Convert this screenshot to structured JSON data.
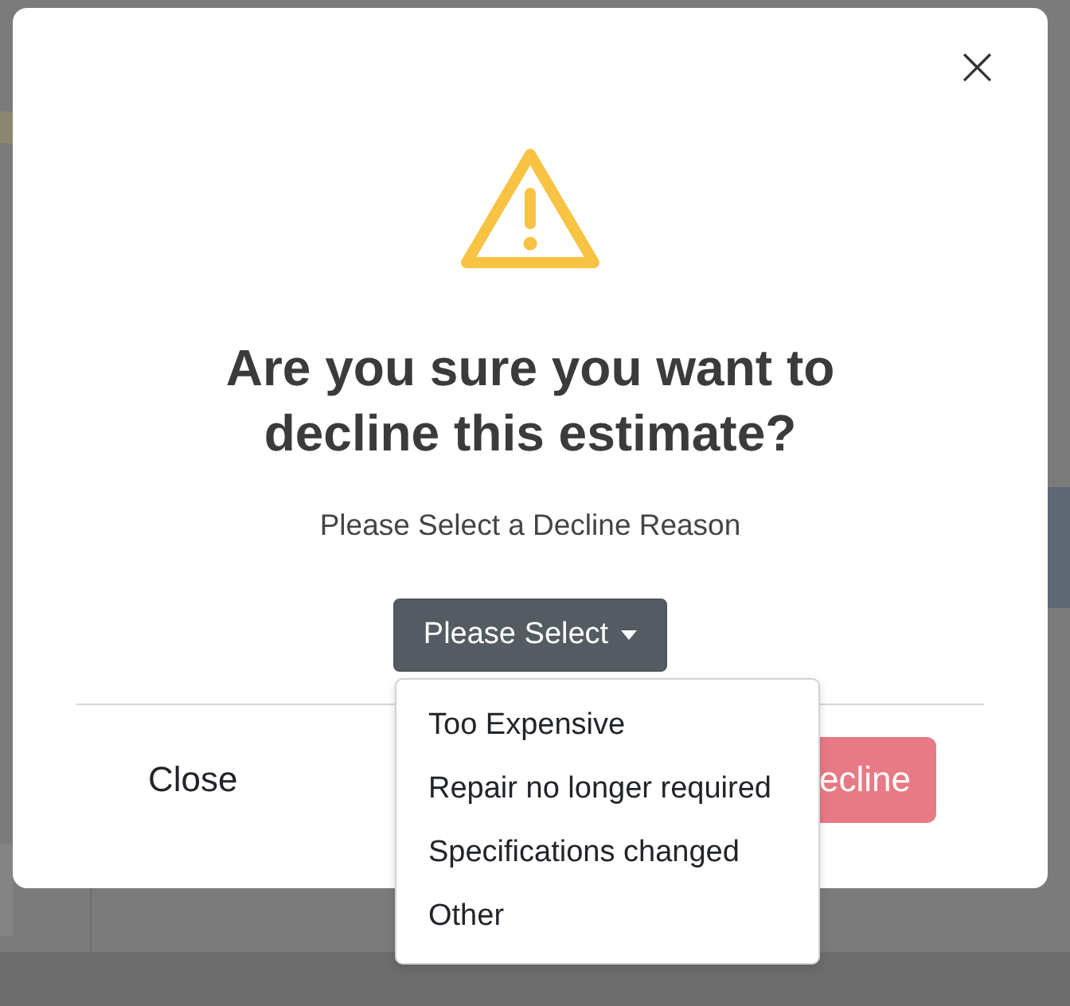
{
  "dialog": {
    "close_icon": "×",
    "title": "Are you sure you want to decline this estimate?",
    "prompt": "Please Select a Decline Reason"
  },
  "reason_dropdown": {
    "label": "Please Select",
    "expanded": true,
    "options": [
      {
        "label": "Too Expensive"
      },
      {
        "label": "Repair no longer required"
      },
      {
        "label": "Specifications changed"
      },
      {
        "label": "Other"
      }
    ]
  },
  "footer": {
    "close_button": "Close",
    "decline_button": "ecline"
  }
}
